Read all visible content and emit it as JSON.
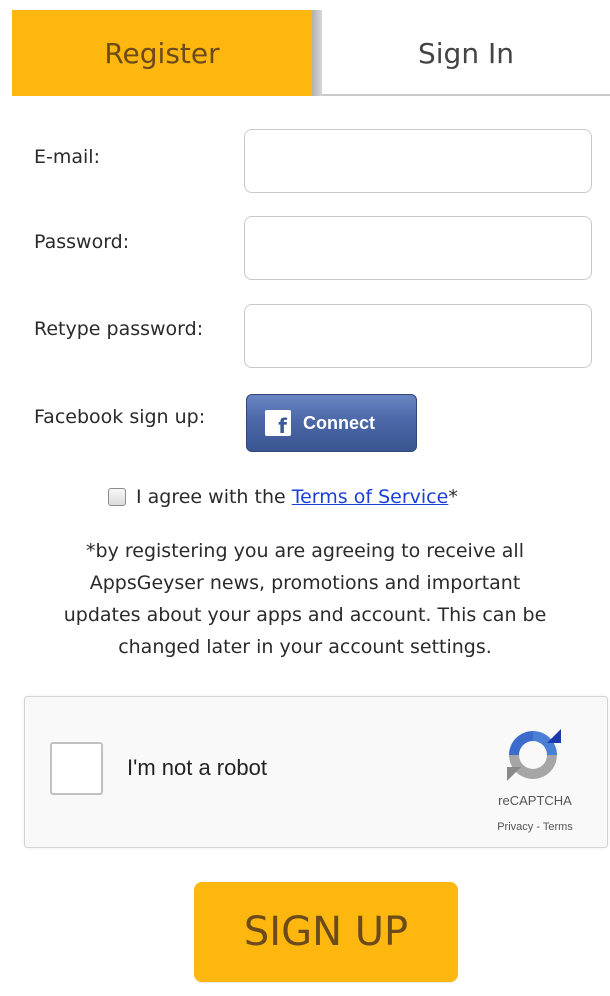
{
  "tabs": {
    "register": "Register",
    "sign_in": "Sign In"
  },
  "form": {
    "email_label": "E-mail:",
    "password_label": "Password:",
    "retype_label": "Retype password:",
    "facebook_label": "Facebook sign up:",
    "email_value": "",
    "password_value": "",
    "retype_value": ""
  },
  "facebook": {
    "icon_glyph": "f",
    "button_label": "Connect",
    "icon": "facebook-icon"
  },
  "terms": {
    "checked": false,
    "prefix": "I agree with the ",
    "link": "Terms of Service",
    "suffix": "*"
  },
  "notice": {
    "lines": [
      "*by registering you are agreeing to receive all",
      "AppsGeyser news, promotions and important",
      "updates about your apps and account. This can be",
      "changed later in your account settings."
    ]
  },
  "recaptcha": {
    "checked": false,
    "label": "I'm not a robot",
    "brand": "reCAPTCHA",
    "privacy": "Privacy",
    "separator": " - ",
    "terms": "Terms",
    "icon": "recaptcha-logo-icon"
  },
  "signup": {
    "label": "SIGN UP"
  },
  "colors": {
    "accent": "#fdb70f",
    "accent_text": "#6b4a1c",
    "link": "#1a3fd8",
    "facebook": "#3b5998"
  }
}
